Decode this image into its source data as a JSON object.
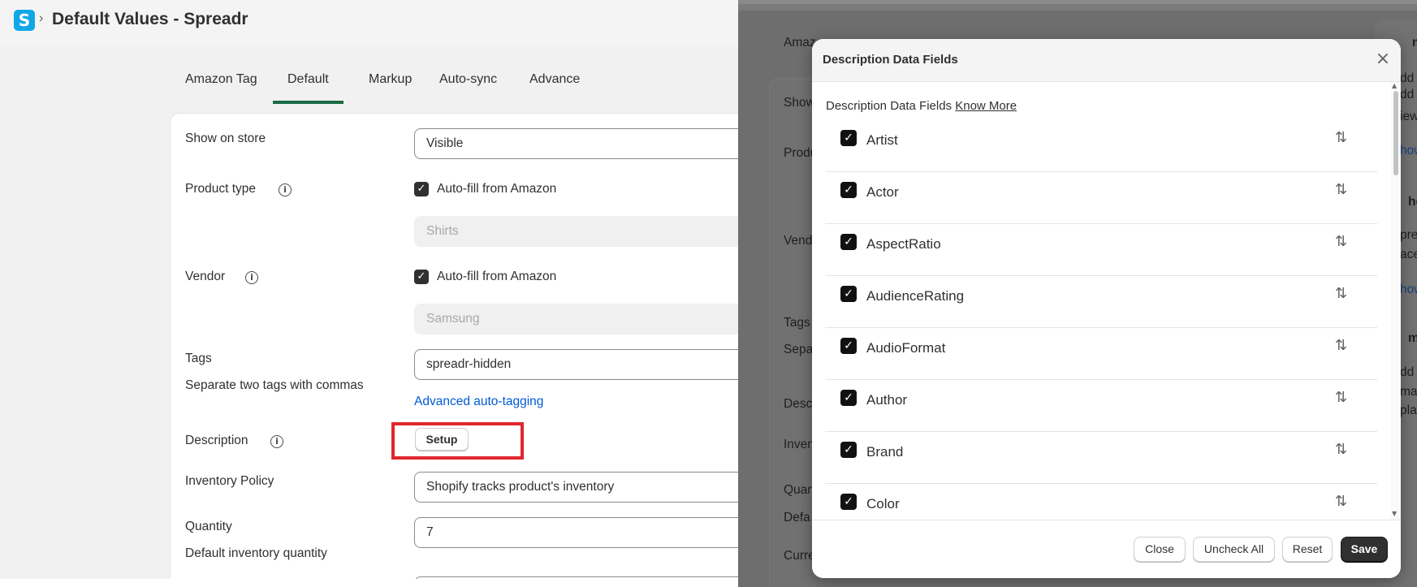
{
  "app": {
    "logo_letter": "S",
    "breadcrumb_sep": "›",
    "title": "Default Values - Spreadr"
  },
  "tabs": [
    {
      "label": "Amazon Tag",
      "active": false
    },
    {
      "label": "Default",
      "active": true
    },
    {
      "label": "Markup",
      "active": false
    },
    {
      "label": "Auto-sync",
      "active": false
    },
    {
      "label": "Advance",
      "active": false
    }
  ],
  "form": {
    "show_on_store": {
      "label": "Show on store",
      "value": "Visible"
    },
    "product_type": {
      "label": "Product type",
      "autofill_label": "Auto-fill from Amazon",
      "autofill_checked": true,
      "value": "Shirts"
    },
    "vendor": {
      "label": "Vendor",
      "autofill_label": "Auto-fill from Amazon",
      "autofill_checked": true,
      "value": "Samsung"
    },
    "tags": {
      "label": "Tags",
      "help": "Separate two tags with commas",
      "value": "spreadr-hidden",
      "link": "Advanced auto-tagging"
    },
    "description": {
      "label": "Description",
      "button": "Setup"
    },
    "inventory_policy": {
      "label": "Inventory Policy",
      "value": "Shopify tracks product's inventory"
    },
    "quantity": {
      "label": "Quantity",
      "help": "Default inventory quantity",
      "value": "7"
    }
  },
  "background_right": {
    "labels": [
      "Amaz",
      "Show",
      "Produ",
      "Vend",
      "Tags",
      "Sepa",
      "Desc",
      "Inven",
      "Quan",
      "Defa",
      "Curre"
    ],
    "side_fragments": [
      "ma",
      "dd",
      "dd",
      "iew",
      "how",
      "hop",
      "pre",
      "ace",
      "how",
      "maz",
      "dd",
      "maz",
      "pla"
    ]
  },
  "modal": {
    "title": "Description Data Fields",
    "close_icon": "×",
    "subtitle": "Description Data Fields",
    "know_more": "Know More",
    "fields": [
      {
        "label": "Artist",
        "checked": true
      },
      {
        "label": "Actor",
        "checked": true
      },
      {
        "label": "AspectRatio",
        "checked": true
      },
      {
        "label": "AudienceRating",
        "checked": true
      },
      {
        "label": "AudioFormat",
        "checked": true
      },
      {
        "label": "Author",
        "checked": true
      },
      {
        "label": "Brand",
        "checked": true
      },
      {
        "label": "Color",
        "checked": true
      }
    ],
    "buttons": {
      "close": "Close",
      "uncheck_all": "Uncheck All",
      "reset": "Reset",
      "save": "Save"
    }
  },
  "colors": {
    "primary": "#303030",
    "link": "#005bd3",
    "tab_indicator": "#1a6b45",
    "highlight": "#e0262d",
    "logo": "#11a7e6"
  }
}
